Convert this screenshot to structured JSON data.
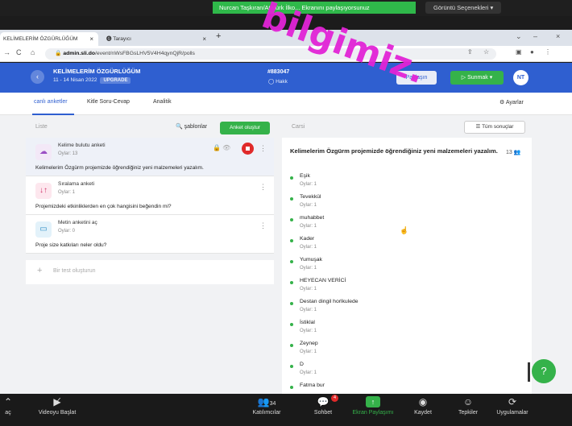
{
  "zoom_top": {
    "share_notice": "Nurcan Taşkıran/Atatürk İlko... Ekranını paylaşıyorsunuz",
    "view_options": "Görüntü Seçenekleri ▾"
  },
  "watermark": "bilgimiz.",
  "browser": {
    "tab1": "KELİMELERİM ÖZGÜRLÜĞÜM",
    "tab2": "Tarayıcı",
    "url_host": "admin.sli.do",
    "url_path": "/event/nWsFBGsLHV5V4H4qynQjR/polls"
  },
  "header": {
    "event_title": "KELİMELERİM ÖZGÜRLÜĞÜM",
    "dates": "11 - 14 Nisan 2022",
    "upgrade": "UPGRADE",
    "code": "#883047",
    "status": "◯ Hakk",
    "share": "Paylaşın",
    "present": "▷ Sunmak ▾",
    "avatar": "NT"
  },
  "tabs": {
    "live": "canlı anketler",
    "qa": "Kitle Soru-Cevap",
    "analytics": "Analitik",
    "settings": "⚙ Ayarlar"
  },
  "left": {
    "list_label": "Liste",
    "templates": "🔍 şablonlar",
    "create": "Anket oluştur",
    "add": "Bir test oluşturun",
    "polls": [
      {
        "type": "Kelime bulutu anketi",
        "votes": "Oylar: 13",
        "question": "Kelimelerim Özgürm projemizde öğrendiğiniz yeni malzemeleri yazalım."
      },
      {
        "type": "Sıralama anketi",
        "votes": "Oylar: 1",
        "question": "Projemizdeki etkinliklerden en çok hangisini beğendin mi?"
      },
      {
        "type": "Metin anketini aç",
        "votes": "Oylar: 0",
        "question": "Proje size katkıları neler oldu?"
      }
    ]
  },
  "right": {
    "current_label": "Carsi",
    "all_results": "☰ Tüm sonuçlar",
    "question": "Kelimelerim Özgürm projemizde öğrendiğiniz yeni malzemeleri yazalım.",
    "count": "13 👥",
    "answers": [
      {
        "text": "Eşik",
        "votes": "Oylar: 1"
      },
      {
        "text": "Tevekkül",
        "votes": "Oylar: 1"
      },
      {
        "text": "muhabbet",
        "votes": "Oylar: 1"
      },
      {
        "text": "Kader",
        "votes": "Oylar: 1"
      },
      {
        "text": "Yumuşak",
        "votes": "Oylar: 1"
      },
      {
        "text": "HEYECAN VERİCİ",
        "votes": "Oylar: 1"
      },
      {
        "text": "Destan dingil horlkulede",
        "votes": "Oylar: 1"
      },
      {
        "text": "İstiklal",
        "votes": "Oylar: 1"
      },
      {
        "text": "Zeynep",
        "votes": "Oylar: 1"
      },
      {
        "text": "D",
        "votes": "Oylar: 1"
      },
      {
        "text": "Fatma bur",
        "votes": ""
      }
    ]
  },
  "zoom_bar": {
    "video_label": "Videoyu Başlat",
    "participants_label": "Katılımcılar",
    "participants_count": "34",
    "chat_label": "Sohbet",
    "chat_badge": "4",
    "share_label": "Ekran Paylaşımı",
    "record_label": "Kaydet",
    "reactions_label": "Tepkiler",
    "apps_label": "Uygulamalar",
    "left_label": "aç"
  }
}
